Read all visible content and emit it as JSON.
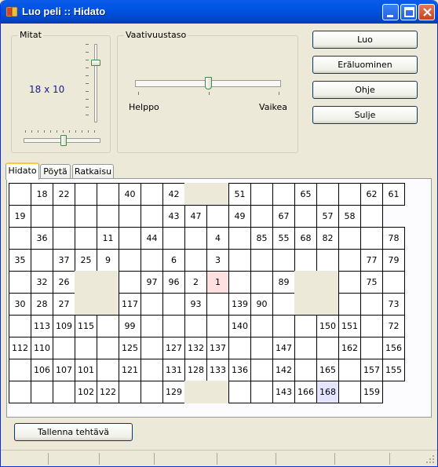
{
  "window": {
    "title": "Luo peli :: Hidato"
  },
  "dimensions": {
    "label": "Mitat",
    "value": "18 x 10"
  },
  "difficulty": {
    "label": "Vaativuustaso",
    "min_label": "Helppo",
    "max_label": "Vaikea",
    "level": 0.5
  },
  "buttons": {
    "create": "Luo",
    "solve": "Eräluominen",
    "help": "Ohje",
    "close": "Sulje",
    "save": "Tallenna tehtävä"
  },
  "tabs": [
    "Hidato",
    "Pöytä",
    "Ratkaisu"
  ],
  "grid": {
    "cols": 18,
    "rows": 10,
    "start_value": "1",
    "end_value": "168",
    "rows_data": [
      [
        "",
        "18",
        "22",
        "",
        "",
        "40",
        "",
        "42",
        "#",
        "#",
        "51",
        "",
        "",
        "65",
        "",
        "",
        "62",
        "61"
      ],
      [
        "19",
        "",
        "",
        "",
        "",
        "",
        "",
        "43",
        "47",
        "",
        "49",
        "",
        "67",
        "",
        "57",
        "58",
        "",
        "-"
      ],
      [
        "",
        "36",
        "",
        "",
        "11",
        "",
        "44",
        "",
        "",
        "4",
        "",
        "85",
        "55",
        "68",
        "82",
        "",
        "",
        "78"
      ],
      [
        "35",
        "",
        "37",
        "25",
        "9",
        "",
        "",
        "6",
        "",
        "3",
        "",
        "",
        "",
        "",
        "",
        "",
        "77",
        "79"
      ],
      [
        "",
        "32",
        "26",
        "#",
        "#",
        "",
        "97",
        "96",
        "2",
        "1",
        "",
        "",
        "89",
        "#",
        "#",
        "",
        "75",
        ""
      ],
      [
        "30",
        "28",
        "27",
        "#",
        "#",
        "117",
        "",
        "",
        "93",
        "",
        "139",
        "90",
        "",
        "#",
        "#",
        "",
        "",
        "73"
      ],
      [
        "",
        "113",
        "109",
        "115",
        "",
        "99",
        "",
        "",
        "",
        "",
        "140",
        "",
        "",
        "",
        "150",
        "151",
        "",
        "72"
      ],
      [
        "112",
        "110",
        "",
        "",
        "",
        "125",
        "",
        "127",
        "132",
        "137",
        "",
        "",
        "147",
        "",
        "",
        "162",
        "",
        "156"
      ],
      [
        "",
        "106",
        "107",
        "101",
        "",
        "121",
        "",
        "131",
        "128",
        "133",
        "136",
        "",
        "142",
        "",
        "165",
        "",
        "157",
        "155"
      ],
      [
        "",
        "",
        "",
        "102",
        "122",
        "",
        "",
        "129",
        "#",
        "#",
        "",
        "",
        "143",
        "166",
        "168",
        "",
        "159",
        "-"
      ]
    ]
  },
  "colors": {
    "title_bar": "#0054E3",
    "start_cell": "#FFE0E0",
    "end_cell": "#E4E4FF",
    "size_text": "#1A1A8C"
  },
  "icons": {
    "app": "book-icon",
    "minimize": "minimize-icon",
    "maximize": "maximize-icon",
    "close": "close-icon"
  }
}
